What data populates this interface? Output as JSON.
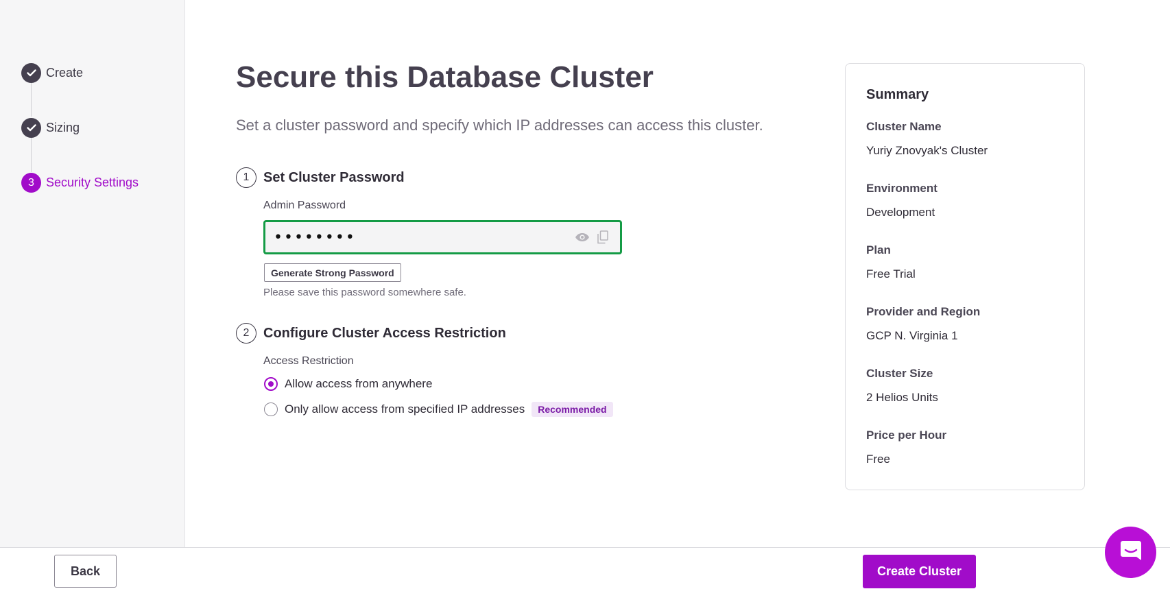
{
  "stepper": {
    "steps": [
      {
        "label": "Create",
        "status": "done"
      },
      {
        "label": "Sizing",
        "status": "done"
      },
      {
        "label": "Security Settings",
        "status": "active",
        "number": "3"
      }
    ]
  },
  "main": {
    "title": "Secure this Database Cluster",
    "subtitle": "Set a cluster password and specify which IP addresses can access this cluster.",
    "password_section": {
      "number": "1",
      "title": "Set Cluster Password",
      "field_label": "Admin Password",
      "value": "••••••••",
      "show_icon": "eye-icon",
      "copy_icon": "copy-icon",
      "generate_label": "Generate Strong Password",
      "hint": "Please save this password somewhere safe."
    },
    "access_section": {
      "number": "2",
      "title": "Configure Cluster Access Restriction",
      "field_label": "Access Restriction",
      "options": [
        {
          "label": "Allow access from anywhere",
          "checked": true
        },
        {
          "label": "Only allow access from specified IP addresses",
          "checked": false,
          "badge": "Recommended"
        }
      ]
    }
  },
  "summary": {
    "title": "Summary",
    "items": [
      {
        "label": "Cluster Name",
        "value": "Yuriy Znovyak's Cluster"
      },
      {
        "label": "Environment",
        "value": "Development"
      },
      {
        "label": "Plan",
        "value": "Free Trial"
      },
      {
        "label": "Provider and Region",
        "value": "GCP N. Virginia 1"
      },
      {
        "label": "Cluster Size",
        "value": "2 Helios Units"
      },
      {
        "label": "Price per Hour",
        "value": "Free"
      }
    ]
  },
  "footer": {
    "back_label": "Back",
    "create_label": "Create Cluster"
  },
  "colors": {
    "accent": "#a10cc9",
    "success_border": "#149b45",
    "step_done": "#45404f"
  },
  "chat": {
    "icon": "chat-icon"
  }
}
